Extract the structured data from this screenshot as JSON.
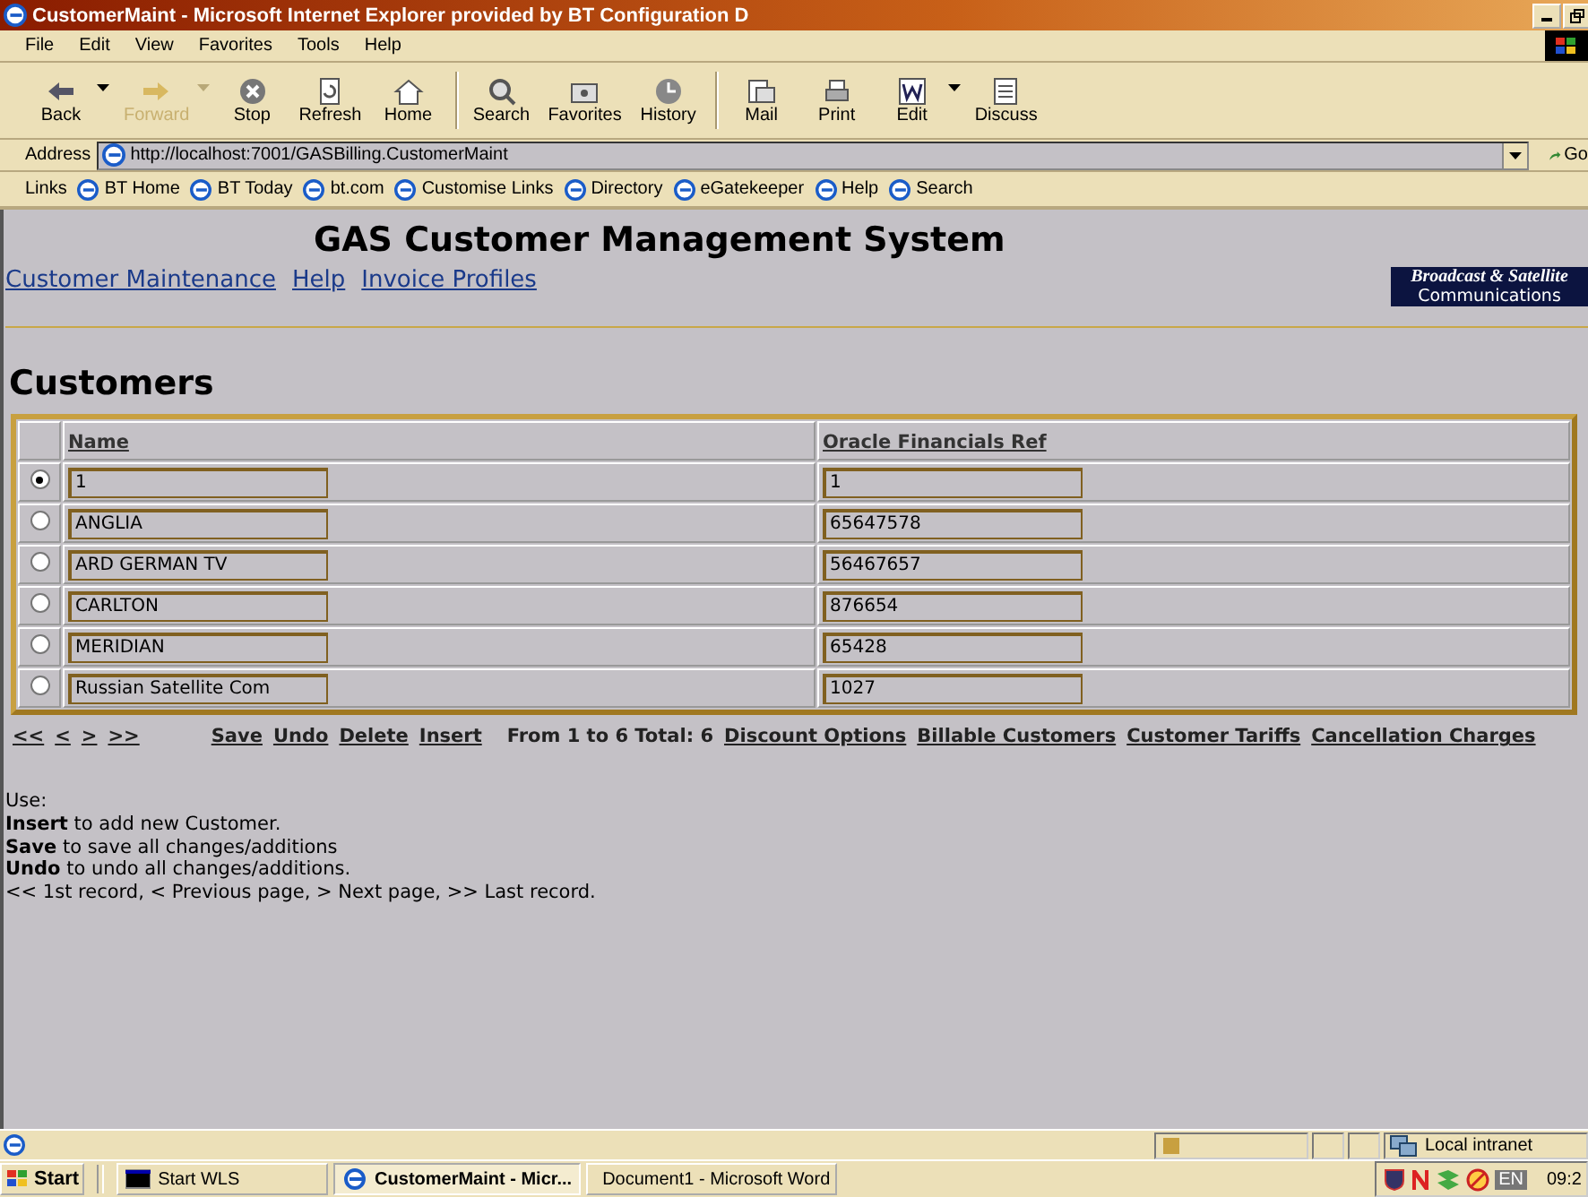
{
  "window": {
    "title": "CustomerMaint - Microsoft Internet Explorer provided by BT Configuration D"
  },
  "menu": [
    "File",
    "Edit",
    "View",
    "Favorites",
    "Tools",
    "Help"
  ],
  "toolbar": [
    {
      "label": "Back",
      "kind": "back",
      "disabled": false,
      "dropdown": true
    },
    {
      "label": "Forward",
      "kind": "forward",
      "disabled": true,
      "dropdown": true
    },
    {
      "label": "Stop",
      "kind": "stop",
      "disabled": false,
      "dropdown": false
    },
    {
      "label": "Refresh",
      "kind": "refresh",
      "disabled": false,
      "dropdown": false
    },
    {
      "label": "Home",
      "kind": "home",
      "disabled": false,
      "dropdown": false
    },
    {
      "label": "Search",
      "kind": "search",
      "disabled": false,
      "dropdown": false
    },
    {
      "label": "Favorites",
      "kind": "favorites",
      "disabled": false,
      "dropdown": false
    },
    {
      "label": "History",
      "kind": "history",
      "disabled": false,
      "dropdown": false
    },
    {
      "label": "Mail",
      "kind": "mail",
      "disabled": false,
      "dropdown": false
    },
    {
      "label": "Print",
      "kind": "print",
      "disabled": false,
      "dropdown": false
    },
    {
      "label": "Edit",
      "kind": "edit",
      "disabled": false,
      "dropdown": true
    },
    {
      "label": "Discuss",
      "kind": "discuss",
      "disabled": false,
      "dropdown": false
    }
  ],
  "address": {
    "label": "Address",
    "value": "http://localhost:7001/GASBilling.CustomerMaint",
    "go": "Go"
  },
  "links": {
    "label": "Links",
    "items": [
      "BT Home",
      "BT Today",
      "bt.com",
      "Customise Links",
      "Directory",
      "eGatekeeper",
      "Help",
      "Search"
    ]
  },
  "page": {
    "title": "GAS Customer Management System",
    "nav": [
      "Customer Maintenance",
      "Help",
      "Invoice Profiles"
    ],
    "logo": [
      "Broadcast & Satellite",
      "Communications"
    ],
    "heading": "Customers",
    "table": {
      "columns": [
        "Name",
        "Oracle Financials Ref"
      ],
      "rows": [
        {
          "selected": true,
          "name": "1",
          "ref": "1"
        },
        {
          "selected": false,
          "name": "ANGLIA",
          "ref": "65647578"
        },
        {
          "selected": false,
          "name": "ARD GERMAN TV",
          "ref": "56467657"
        },
        {
          "selected": false,
          "name": "CARLTON",
          "ref": "876654"
        },
        {
          "selected": false,
          "name": "MERIDIAN",
          "ref": "65428"
        },
        {
          "selected": false,
          "name": "Russian Satellite Com",
          "ref": "1027"
        }
      ]
    },
    "pager": [
      "<<",
      "<",
      ">",
      ">>"
    ],
    "actions": [
      "Save",
      "Undo",
      "Delete",
      "Insert"
    ],
    "record_info": "From 1 to 6 Total: 6",
    "extra_links": [
      "Discount Options",
      "Billable Customers",
      "Customer Tariffs",
      "Cancellation Charges"
    ],
    "help": [
      "Use:",
      "**Insert** to add new Customer.",
      "**Save** to save all changes/additions",
      "**Undo** to undo all changes/additions.",
      "<< 1st record, < Previous page, > Next page, >> Last record."
    ]
  },
  "status_bar": {
    "zone": "Local intranet"
  },
  "taskbar": {
    "start": "Start",
    "items": [
      {
        "label": "Start WLS",
        "kind": "console",
        "selected": false
      },
      {
        "label": "CustomerMaint - Micr...",
        "kind": "ie",
        "selected": true
      },
      {
        "label": "Document1 - Microsoft Word",
        "kind": "word",
        "selected": false
      }
    ],
    "language": "EN",
    "clock": "09:2"
  }
}
